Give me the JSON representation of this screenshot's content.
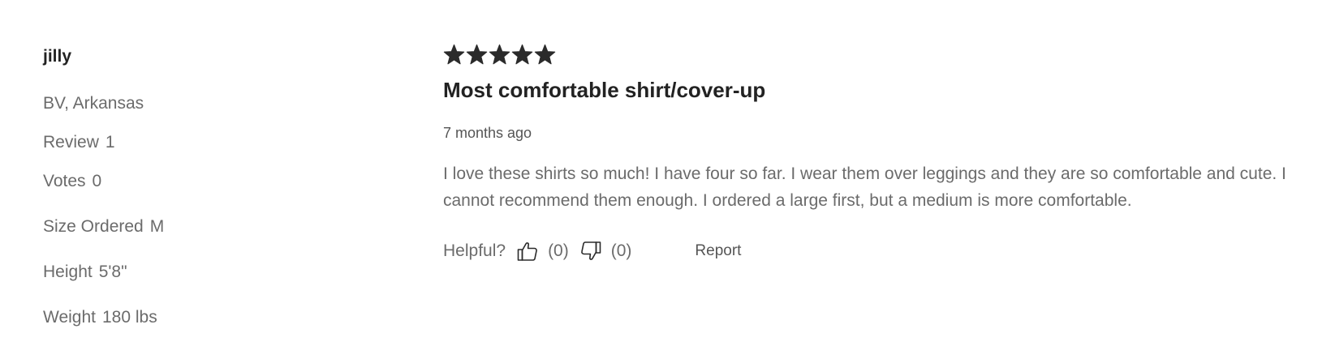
{
  "reviewer": {
    "name": "jilly",
    "location": "BV, Arkansas",
    "review_label": "Review",
    "review_count": "1",
    "votes_label": "Votes",
    "votes_count": "0",
    "size_label": "Size Ordered",
    "size_value": "M",
    "height_label": "Height",
    "height_value": "5'8\"",
    "weight_label": "Weight",
    "weight_value": "180 lbs"
  },
  "review": {
    "rating": 5,
    "rating_max": 5,
    "star_color": "#2b2b2b",
    "title": "Most comfortable shirt/cover-up",
    "date": "7 months ago",
    "text": "I love these shirts so much! I have four so far. I wear them over leggings and they are so comfortable and cute. I cannot recommend them enough. I ordered a large first, but a medium is more comfortable."
  },
  "feedback": {
    "helpful_label": "Helpful?",
    "thumbs_up_icon": "thumbs-up-icon",
    "up_count": "(0)",
    "thumbs_down_icon": "thumbs-down-icon",
    "down_count": "(0)",
    "report_label": "Report"
  }
}
